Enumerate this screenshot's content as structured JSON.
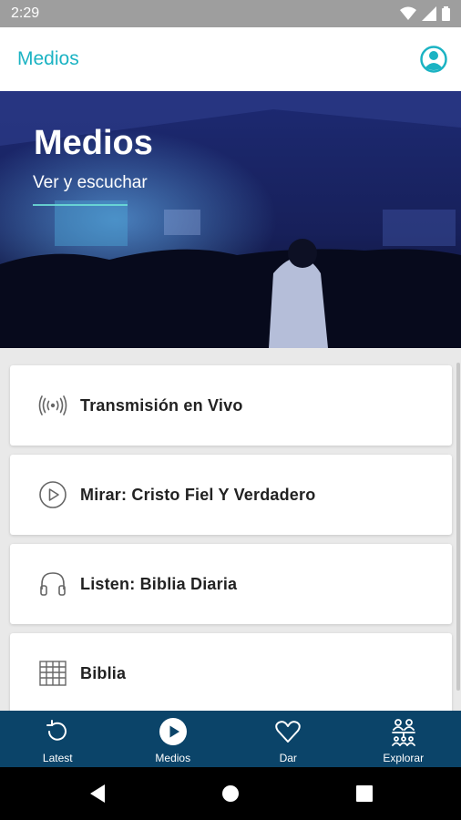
{
  "status_bar": {
    "time": "2:29",
    "icons": [
      "wifi-icon",
      "signal-icon",
      "battery-icon"
    ]
  },
  "app_bar": {
    "title": "Medios",
    "profile_icon": "account-circle-icon",
    "accent": "#1bb3c3"
  },
  "hero": {
    "title": "Medios",
    "subtitle": "Ver y escuchar"
  },
  "list": {
    "items": [
      {
        "label": "Transmisión en Vivo",
        "icon": "live-broadcast-icon"
      },
      {
        "label": "Mirar: Cristo Fiel Y Verdadero",
        "icon": "play-circle-icon"
      },
      {
        "label": "Listen: Biblia Diaria",
        "icon": "headphones-icon"
      },
      {
        "label": "Biblia",
        "icon": "book-grid-icon"
      }
    ]
  },
  "bottom_nav": {
    "background": "#0b4469",
    "items": [
      {
        "label": "Latest",
        "icon": "history-icon"
      },
      {
        "label": "Medios",
        "icon": "play-circle-filled-icon"
      },
      {
        "label": "Dar",
        "icon": "heart-icon"
      },
      {
        "label": "Explorar",
        "icon": "people-network-icon"
      }
    ]
  },
  "system_nav": {
    "buttons": [
      "back-icon",
      "home-icon",
      "recents-icon"
    ]
  }
}
